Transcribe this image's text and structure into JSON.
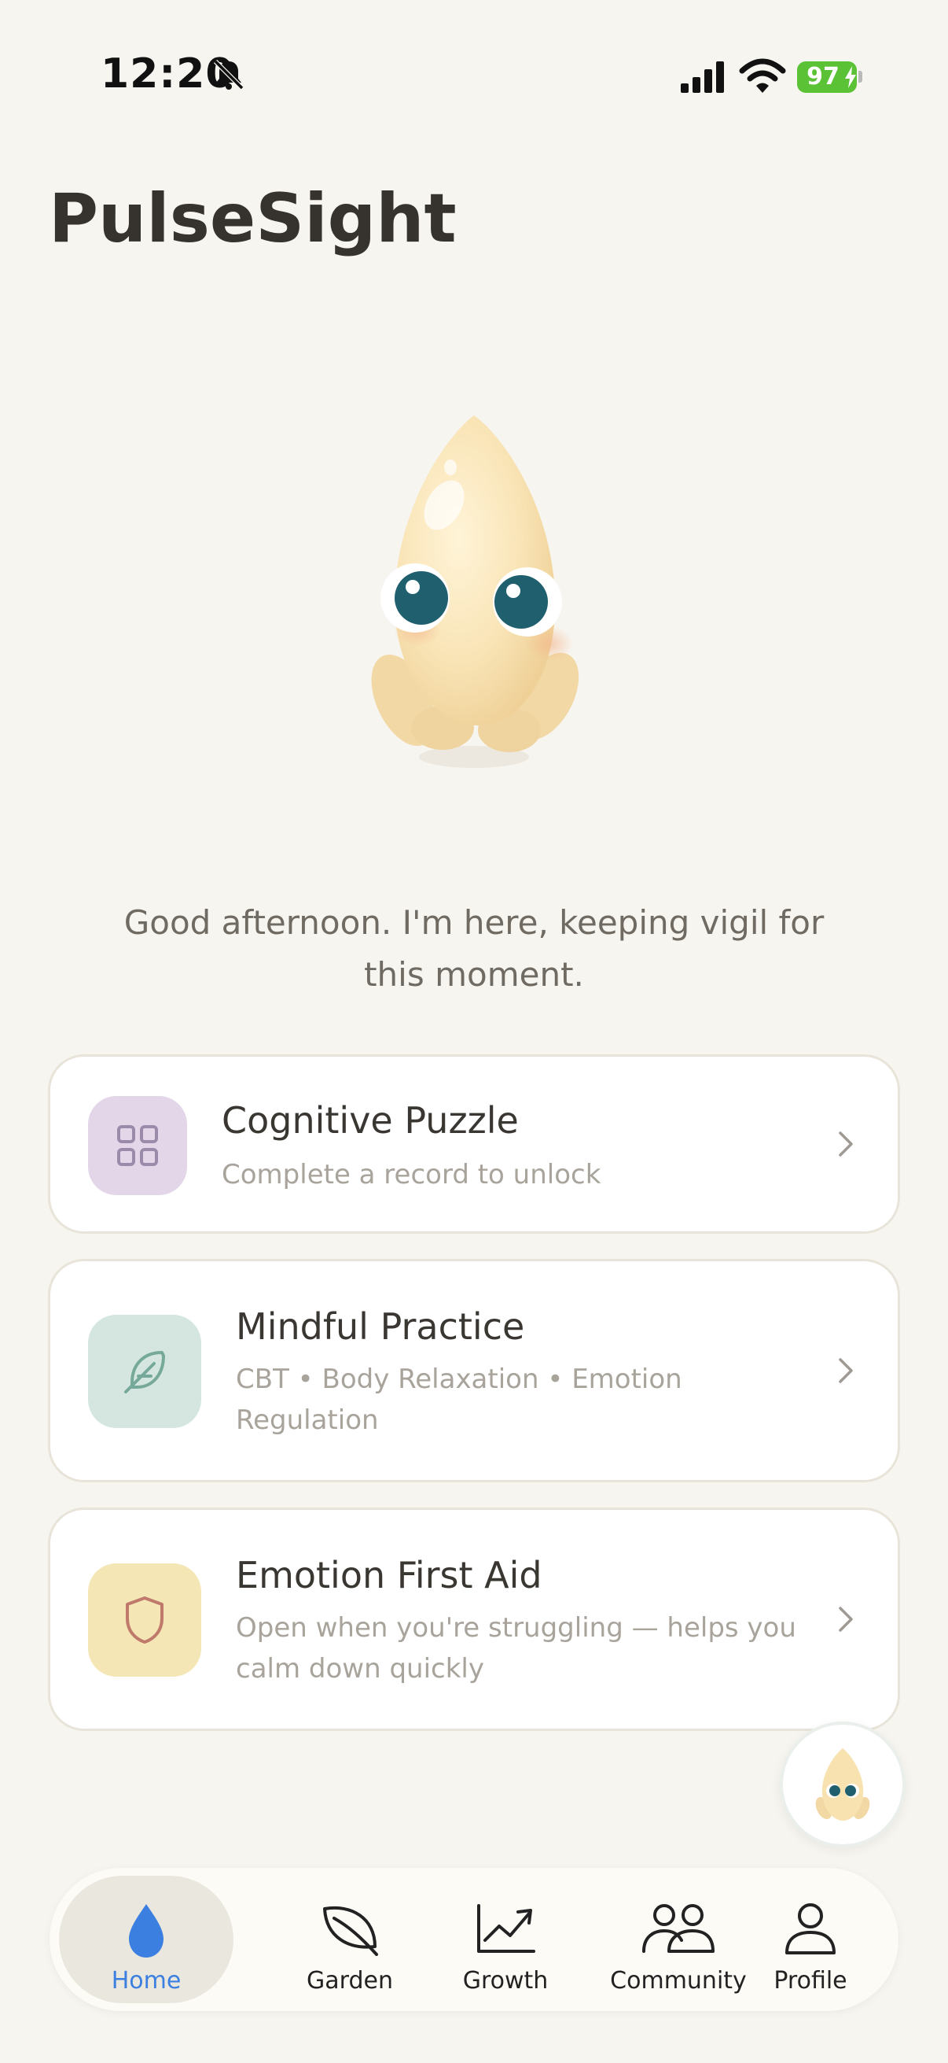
{
  "status_bar": {
    "time": "12:20",
    "battery_level": "97",
    "icons": [
      "bell-slash-icon",
      "cellular-signal-icon",
      "wifi-icon",
      "battery-charging-icon"
    ]
  },
  "app": {
    "title": "PulseSight",
    "mascot": "droplet-mascot"
  },
  "greeting": "Good afternoon. I'm here, keeping vigil for this moment.",
  "cards": [
    {
      "title": "Cognitive Puzzle",
      "subtitle": "Complete a record to unlock",
      "icon": "grid-icon",
      "icon_bg": "#e2d6e8"
    },
    {
      "title": "Mindful Practice",
      "subtitle": "CBT  •  Body Relaxation  •  Emotion Regulation",
      "icon": "feather-icon",
      "icon_bg": "#d4e6df"
    },
    {
      "title": "Emotion First Aid",
      "subtitle": "Open when you're struggling — helps you calm down quickly",
      "icon": "shield-icon",
      "icon_bg": "#f4e6b5"
    }
  ],
  "tabs": [
    {
      "label": "Home",
      "icon": "droplet-icon",
      "active": true
    },
    {
      "label": "Garden",
      "icon": "leaf-icon",
      "active": false
    },
    {
      "label": "Growth",
      "icon": "trending-chart-icon",
      "active": false
    },
    {
      "label": "Community",
      "icon": "people-icon",
      "active": false
    },
    {
      "label": "Profile",
      "icon": "person-icon",
      "active": false
    }
  ],
  "colors": {
    "background": "#f7f5f0",
    "accent_blue": "#3b7fe0",
    "battery_green": "#5bc236",
    "mascot_body": "#f8e2b0"
  }
}
